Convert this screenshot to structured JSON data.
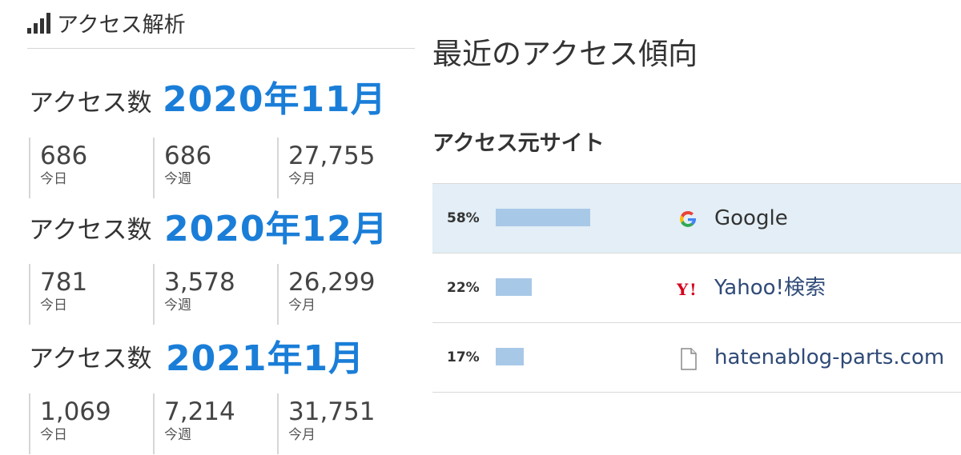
{
  "left_panel": {
    "header": {
      "title": "アクセス解析",
      "icon": "signal-bars-icon"
    },
    "blocks": [
      {
        "label": "アクセス数",
        "month": "2020年11月",
        "stats": [
          {
            "value": "686",
            "unit": "今日"
          },
          {
            "value": "686",
            "unit": "今週"
          },
          {
            "value": "27,755",
            "unit": "今月"
          }
        ]
      },
      {
        "label": "アクセス数",
        "month": "2020年12月",
        "stats": [
          {
            "value": "781",
            "unit": "今日"
          },
          {
            "value": "3,578",
            "unit": "今週"
          },
          {
            "value": "26,299",
            "unit": "今月"
          }
        ]
      },
      {
        "label": "アクセス数",
        "month": "2021年1月",
        "stats": [
          {
            "value": "1,069",
            "unit": "今日"
          },
          {
            "value": "7,214",
            "unit": "今週"
          },
          {
            "value": "31,751",
            "unit": "今月"
          }
        ]
      }
    ]
  },
  "right_panel": {
    "title": "最近のアクセス傾向",
    "sites_heading": "アクセス元サイト",
    "sites": [
      {
        "percent_label": "58%",
        "share": 58,
        "name": "Google",
        "icon": "google-icon",
        "highlighted": true
      },
      {
        "percent_label": "22%",
        "share": 22,
        "name": "Yahoo!検索",
        "icon": "yahoo-icon",
        "highlighted": false
      },
      {
        "percent_label": "17%",
        "share": 17,
        "name": "hatenablog-parts.com",
        "icon": "page-icon",
        "highlighted": false
      }
    ]
  },
  "colors": {
    "month_accent": "#1a7ed8",
    "bar": "#a8c8e8",
    "highlight_row": "#e3eef6",
    "link_text": "#2f4a77"
  }
}
